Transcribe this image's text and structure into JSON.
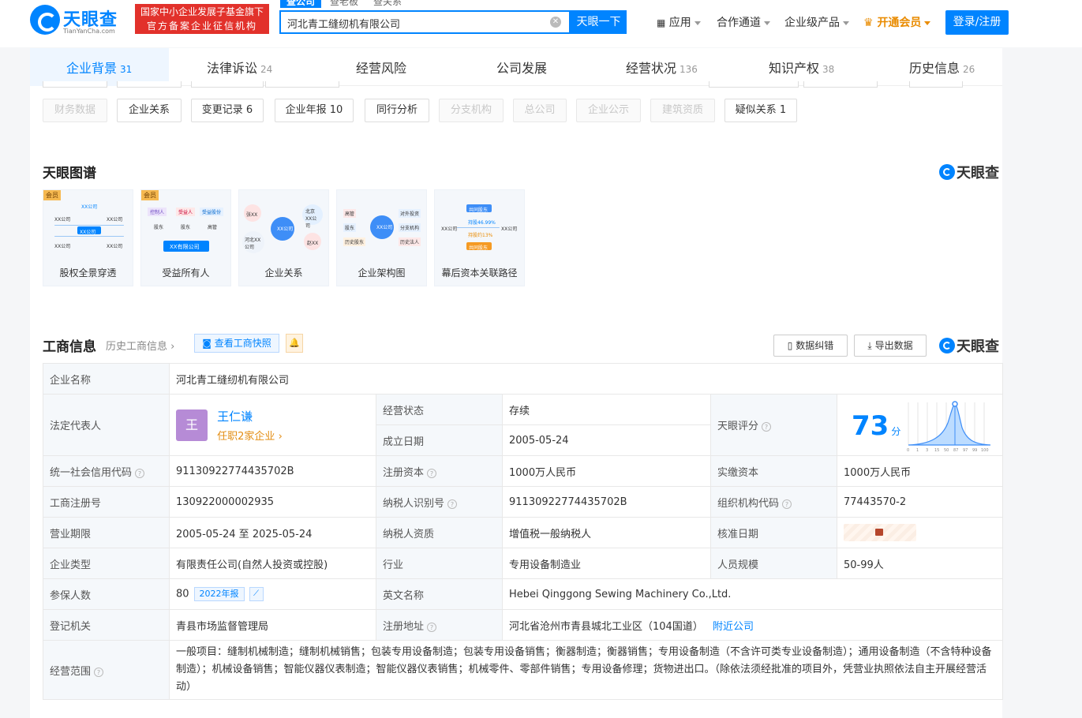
{
  "header": {
    "logo_text": "天眼查",
    "logo_sub": "TianYanCha.com",
    "gov_badge_line1": "国家中小企业发展子基金旗下",
    "gov_badge_line2": "官方备案企业征信机构",
    "search_tabs": [
      "查公司",
      "查老板",
      "查关系"
    ],
    "search_value": "河北青工缝纫机有限公司",
    "search_button": "天眼一下",
    "nav": [
      "应用",
      "合作通道",
      "企业级产品",
      "开通会员"
    ],
    "login": "登录/注册"
  },
  "main_tabs": [
    {
      "label": "企业背景",
      "count": "31"
    },
    {
      "label": "法律诉讼",
      "count": "24"
    },
    {
      "label": "经营风险",
      "count": ""
    },
    {
      "label": "公司发展",
      "count": ""
    },
    {
      "label": "经营状况",
      "count": "136"
    },
    {
      "label": "知识产权",
      "count": "38"
    },
    {
      "label": "历史信息",
      "count": "26"
    }
  ],
  "chips": [
    "财务数据",
    "企业关系",
    "变更记录 6",
    "企业年报 10",
    "同行分析",
    "分支机构",
    "总公司",
    "企业公示",
    "建筑资质",
    "疑似关系 1"
  ],
  "graph": {
    "title": "天眼图谱",
    "brand": "天眼查",
    "member_tag": "会员",
    "cards": [
      "股权全景穿透",
      "受益所有人",
      "企业关系",
      "企业架构图",
      "幕后资本关联路径"
    ],
    "mini": {
      "xx_company": "XX公司",
      "xx_limited": "XX有限公司",
      "c2_tags": [
        "控制人",
        "受益人",
        "受益股份"
      ],
      "c2_roles": [
        "股东",
        "股东",
        "高管"
      ],
      "c3_nodes": [
        "张XX",
        "北京XX公司",
        "河北XX公司",
        "赵XX"
      ],
      "c4_left": [
        "高管",
        "股东",
        "历史股东"
      ],
      "c4_right": [
        "对外投资",
        "分支机构",
        "历史法人"
      ],
      "c5_labels": [
        "共同股东",
        "持股46.99%",
        "持股约13%",
        "共同股东"
      ]
    }
  },
  "gongshang": {
    "title": "工商信息",
    "history_link": "历史工商信息",
    "snapshot_btn": "查看工商快照",
    "correct_btn": "数据纠错",
    "export_btn": "导出数据",
    "brand": "天眼查",
    "company_name_label": "企业名称",
    "company_name": "河北青工缝纫机有限公司",
    "legal_label": "法定代表人",
    "legal_avatar": "王",
    "legal_name": "王仁谦",
    "legal_sub": "任职2家企业",
    "status_label": "经营状态",
    "status": "存续",
    "founded_label": "成立日期",
    "founded": "2005-05-24",
    "score_label": "天眼评分",
    "score": "73",
    "score_unit": "分",
    "score_axis": [
      "0",
      "1",
      "3",
      "15",
      "50",
      "87",
      "97",
      "99",
      "100"
    ],
    "credit_code_label": "统一社会信用代码",
    "credit_code": "91130922774435702B",
    "reg_capital_label": "注册资本",
    "reg_capital": "1000万人民币",
    "paid_capital_label": "实缴资本",
    "paid_capital": "1000万人民币",
    "reg_no_label": "工商注册号",
    "reg_no": "130922000002935",
    "tax_id_label": "纳税人识别号",
    "tax_id": "91130922774435702B",
    "org_code_label": "组织机构代码",
    "org_code": "77443570-2",
    "term_label": "营业期限",
    "term": "2005-05-24 至 2025-05-24",
    "tax_qual_label": "纳税人资质",
    "tax_qual": "增值税一般纳税人",
    "approve_label": "核准日期",
    "type_label": "企业类型",
    "type": "有限责任公司(自然人投资或控股)",
    "industry_label": "行业",
    "industry": "专用设备制造业",
    "staff_label": "人员规模",
    "staff": "50-99人",
    "insured_label": "参保人数",
    "insured": "80",
    "insured_year": "2022年报",
    "en_name_label": "英文名称",
    "en_name": "Hebei Qinggong Sewing Machinery Co.,Ltd.",
    "authority_label": "登记机关",
    "authority": "青县市场监督管理局",
    "address_label": "注册地址",
    "address": "河北省沧州市青县城北工业区（104国道）",
    "nearby": "附近公司",
    "scope_label": "经营范围",
    "scope": "一般项目：缝制机械制造；缝制机械销售；包装专用设备制造；包装专用设备销售；衡器制造；衡器销售；专用设备制造（不含许可类专业设备制造）；通用设备制造（不含特种设备制造）；机械设备销售；智能仪器仪表制造；智能仪器仪表销售；机械零件、零部件销售；专用设备修理；货物进出口。（除依法须经批准的项目外，凭营业执照依法自主开展经营活动）"
  }
}
